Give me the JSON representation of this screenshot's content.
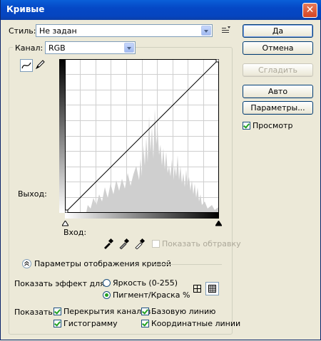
{
  "window": {
    "title": "Кривые",
    "close_glyph": "✕"
  },
  "style_row": {
    "label": "Стиль:",
    "value": "Не задан"
  },
  "channel_row": {
    "label": "Канал:",
    "value": "RGB"
  },
  "buttons": {
    "ok": "Да",
    "cancel": "Отмена",
    "smooth": "Сгладить",
    "auto": "Авто",
    "options": "Параметры..."
  },
  "preview": {
    "label": "Просмотр",
    "checked": true
  },
  "curve": {
    "output_label": "Выход:",
    "input_label": "Вход:",
    "show_clipping": {
      "label": "Показать обтравку",
      "checked": false,
      "enabled": false
    }
  },
  "display_options": {
    "header": "Параметры отображения кривой",
    "show_amount_label": "Показать эффект для:",
    "light_label": "Яркость (0-255)",
    "pigment_label": "Пигмент/Краска %",
    "selected": "pigment",
    "show_label": "Показать:",
    "channel_overlays": "Перекрытия каналов",
    "baseline": "Базовую линию",
    "histogram": "Гистограмму",
    "intersection_line": "Координатные линии"
  },
  "colors": {
    "accent": "#0a246a",
    "titlebar": "#0548c6",
    "histogram": "#c8c8c8"
  }
}
